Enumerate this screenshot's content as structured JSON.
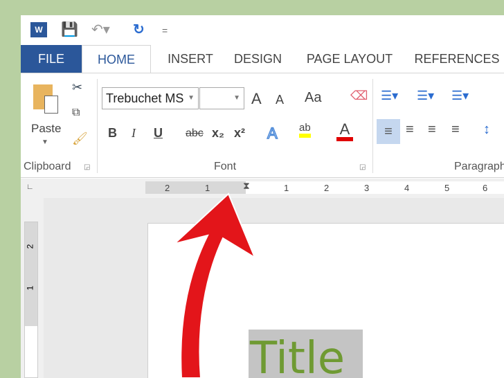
{
  "quick_access": {
    "word_icon": "W",
    "save_icon": "save-icon",
    "undo_icon": "undo-icon",
    "redo_icon": "redo-icon",
    "customize": "="
  },
  "tabs": [
    {
      "label": "FILE"
    },
    {
      "label": "HOME"
    },
    {
      "label": "INSERT"
    },
    {
      "label": "DESIGN"
    },
    {
      "label": "PAGE LAYOUT"
    },
    {
      "label": "REFERENCES"
    }
  ],
  "clipboard": {
    "paste": "Paste",
    "label": "Clipboard"
  },
  "font": {
    "name": "Trebuchet MS",
    "size": "",
    "label": "Font",
    "bold": "B",
    "italic": "I",
    "underline": "U",
    "strike": "abc",
    "sub": "x₂",
    "sup": "x²",
    "grow": "A",
    "shrink": "A",
    "case": "Aa",
    "text_effects": "A",
    "highlight": "ab",
    "font_color": "A",
    "highlight_color": "#ffff00",
    "font_color_value": "#e00000"
  },
  "paragraph": {
    "label": "Paragraph"
  },
  "ruler": {
    "left": [
      "2",
      "1"
    ],
    "right": [
      "1",
      "2",
      "3",
      "4",
      "5",
      "6"
    ],
    "vertical": [
      "2",
      "1"
    ]
  },
  "document": {
    "title": "Title"
  },
  "colors": {
    "accent": "#2b579a",
    "title_text": "#6f9a33",
    "arrow": "#e3151a"
  }
}
